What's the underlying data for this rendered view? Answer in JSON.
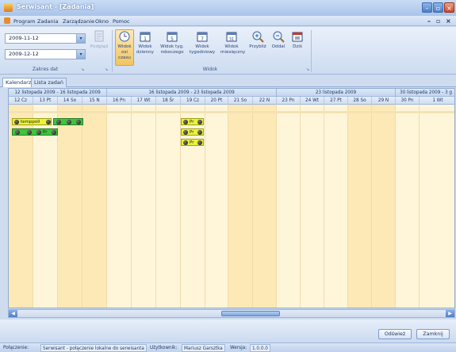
{
  "window": {
    "title": "Serwisant - [Zadania]"
  },
  "menu": [
    "Program",
    "Zadania",
    "Zarządzanie",
    "Okno",
    "Pomoc"
  ],
  "ribbon": {
    "date_from": "2009-11-12",
    "date_to": "2009-12-12",
    "group_zakres_label": "Zakres dat",
    "podglad_label": "Podgląd",
    "buttons": [
      {
        "label": "Widok osi czasu"
      },
      {
        "label": "Widok dzienny"
      },
      {
        "label": "Widok tyg. roboczego"
      },
      {
        "label": "Widok tygodniowy"
      },
      {
        "label": "Widok miesięczny"
      },
      {
        "label": "Przybliż"
      },
      {
        "label": "Oddal"
      },
      {
        "label": "Dziś"
      }
    ],
    "group_widok_label": "Widok"
  },
  "tabs": [
    "Kalendarz",
    "Lista zadań"
  ],
  "calendar": {
    "weeks": [
      "12 listopada 2009 - 16 listopada 2009",
      "16 listopada 2009 - 23 listopada 2009",
      "23 listopada 2009",
      "30 listopada 2009 - 3 g"
    ],
    "days": [
      "12 Cz",
      "13 Pt",
      "14 So",
      "15 N",
      "16 Pn",
      "17 Wt",
      "18 Śr",
      "19 Cz",
      "20 Pt",
      "21 So",
      "22 N",
      "23 Pn",
      "24 Wt",
      "27 Pt",
      "28 So",
      "29 N",
      "30 Pn",
      "1 Wt"
    ],
    "events": {
      "first_label": "temppoll",
      "short_label": "Pr"
    }
  },
  "buttons": {
    "refresh": "Odśwież",
    "close": "Zamknij"
  },
  "status": {
    "conn_label": "Połączenie:",
    "conn_value": "Serwisant - połączenie lokalne do serwisanta",
    "user_label": "Użytkownik:",
    "user_value": "Mariusz Garsztka",
    "version_label": "Wersja:",
    "version_value": "1.0.0.0"
  },
  "colors": {
    "accent": "#f2c45f",
    "event_green": "#3fc43c",
    "event_yellow": "#ecf23a",
    "weekend": "#fde9b6"
  }
}
